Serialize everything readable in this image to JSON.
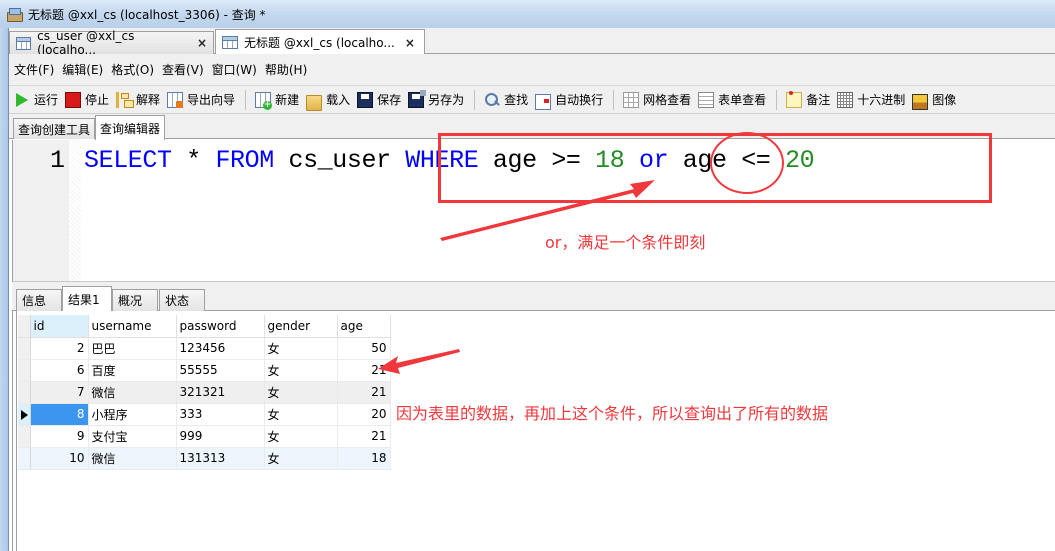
{
  "window": {
    "title": "无标题 @xxl_cs (localhost_3306) - 查询 *"
  },
  "document_tabs": [
    {
      "label": "cs_user @xxl_cs (localho...",
      "close": "×",
      "active": false
    },
    {
      "label": "无标题 @xxl_cs (localho...",
      "close": "×",
      "active": true
    }
  ],
  "menu": [
    {
      "label": "文件(F)"
    },
    {
      "label": "编辑(E)"
    },
    {
      "label": "格式(O)"
    },
    {
      "label": "查看(V)"
    },
    {
      "label": "窗口(W)"
    },
    {
      "label": "帮助(H)"
    }
  ],
  "toolbar": {
    "run": {
      "label": "运行",
      "icon": "play-icon"
    },
    "stop": {
      "label": "停止",
      "icon": "stop-icon"
    },
    "explain": {
      "label": "解释",
      "icon": "explain-icon"
    },
    "export": {
      "label": "导出向导",
      "icon": "export-wizard-icon"
    },
    "new": {
      "label": "新建",
      "icon": "new-query-icon"
    },
    "load": {
      "label": "载入",
      "icon": "folder-open-icon"
    },
    "save": {
      "label": "保存",
      "icon": "save-icon"
    },
    "save_as": {
      "label": "另存为",
      "icon": "save-as-icon"
    },
    "find": {
      "label": "查找",
      "icon": "search-icon"
    },
    "word_wrap": {
      "label": "自动换行",
      "icon": "word-wrap-icon"
    },
    "grid_view": {
      "label": "网格查看",
      "icon": "grid-view-icon"
    },
    "form_view": {
      "label": "表单查看",
      "icon": "form-view-icon"
    },
    "memo": {
      "label": "备注",
      "icon": "memo-icon"
    },
    "hex": {
      "label": "十六进制",
      "icon": "hex-icon"
    },
    "image": {
      "label": "图像",
      "icon": "image-icon"
    }
  },
  "query_tabs": [
    {
      "label": "查询创建工具",
      "active": false
    },
    {
      "label": "查询编辑器",
      "active": true
    }
  ],
  "editor": {
    "line_number": "1",
    "tokens": {
      "select": "SELECT",
      "star": " * ",
      "from": "FROM",
      "table": " cs_user ",
      "where": "WHERE",
      "cond1": " age >= ",
      "val1": "18",
      "space1": " ",
      "or": "or",
      "cond2": " age <= ",
      "val2": "20"
    }
  },
  "result_tabs": [
    {
      "label": "信息",
      "active": false
    },
    {
      "label": "结果1",
      "active": true
    },
    {
      "label": "概况",
      "active": false
    },
    {
      "label": "状态",
      "active": false
    }
  ],
  "results": {
    "columns": [
      "id",
      "username",
      "password",
      "gender",
      "age"
    ],
    "rows": [
      {
        "id": "2",
        "username": "巴巴",
        "password": "123456",
        "gender": "女",
        "age": "50"
      },
      {
        "id": "6",
        "username": "百度",
        "password": "55555",
        "gender": "女",
        "age": "21"
      },
      {
        "id": "7",
        "username": "微信",
        "password": "321321",
        "gender": "女",
        "age": "21"
      },
      {
        "id": "8",
        "username": "小程序",
        "password": "333",
        "gender": "女",
        "age": "20"
      },
      {
        "id": "9",
        "username": "支付宝",
        "password": "999",
        "gender": "女",
        "age": "21"
      },
      {
        "id": "10",
        "username": "微信",
        "password": "131313",
        "gender": "女",
        "age": "18"
      }
    ],
    "current_row_index": 3
  },
  "annotations": {
    "note_or": "or，满足一个条件即刻",
    "note_all": "因为表里的数据，再加上这个条件，所以查询出了所有的数据",
    "color": "#f0383c"
  }
}
